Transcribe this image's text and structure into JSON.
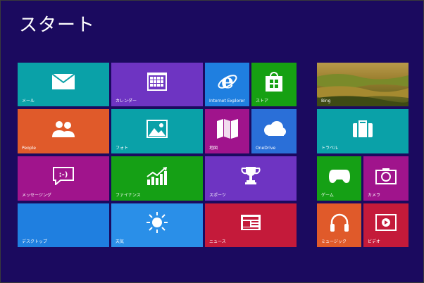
{
  "header": {
    "title": "スタート"
  },
  "tiles": {
    "mail": {
      "label": "メール",
      "color": "#0aa1a8",
      "icon": "mail-icon"
    },
    "calendar": {
      "label": "カレンダー",
      "color": "#6e34c2",
      "icon": "calendar-icon"
    },
    "ie": {
      "label": "Internet Explorer",
      "color": "#1f7fe0",
      "icon": "internet-explorer-icon"
    },
    "store": {
      "label": "ストア",
      "color": "#16a012",
      "icon": "store-bag-icon"
    },
    "bing": {
      "label": "Bing",
      "color": "#8a7a2a",
      "icon": "bing-landscape-image"
    },
    "people": {
      "label": "People",
      "color": "#e05a2a",
      "icon": "people-icon"
    },
    "photos": {
      "label": "フォト",
      "color": "#0aa1a8",
      "icon": "photo-icon"
    },
    "maps": {
      "label": "地図",
      "color": "#a0148c",
      "icon": "map-icon"
    },
    "onedrive": {
      "label": "OneDrive",
      "color": "#2a6fd8",
      "icon": "cloud-icon"
    },
    "travel": {
      "label": "トラベル",
      "color": "#0aa1a8",
      "icon": "suitcase-icon"
    },
    "messaging": {
      "label": "メッセージング",
      "color": "#a0148c",
      "icon": "message-icon"
    },
    "finance": {
      "label": "ファイナンス",
      "color": "#15a015",
      "icon": "finance-chart-icon"
    },
    "sports": {
      "label": "スポーツ",
      "color": "#6e34c2",
      "icon": "trophy-icon"
    },
    "games": {
      "label": "ゲーム",
      "color": "#15a015",
      "icon": "xbox-controller-icon"
    },
    "camera": {
      "label": "カメラ",
      "color": "#a0148c",
      "icon": "camera-icon"
    },
    "desktop": {
      "label": "デスクトップ",
      "color": "#1f7fe0",
      "icon": "desktop-tile"
    },
    "weather": {
      "label": "天気",
      "color": "#2a8fe8",
      "icon": "sun-icon"
    },
    "news": {
      "label": "ニュース",
      "color": "#c41a3a",
      "icon": "newspaper-icon"
    },
    "music": {
      "label": "ミュージック",
      "color": "#e05a2a",
      "icon": "headphones-icon"
    },
    "video": {
      "label": "ビデオ",
      "color": "#c41a3a",
      "icon": "video-play-icon"
    }
  }
}
